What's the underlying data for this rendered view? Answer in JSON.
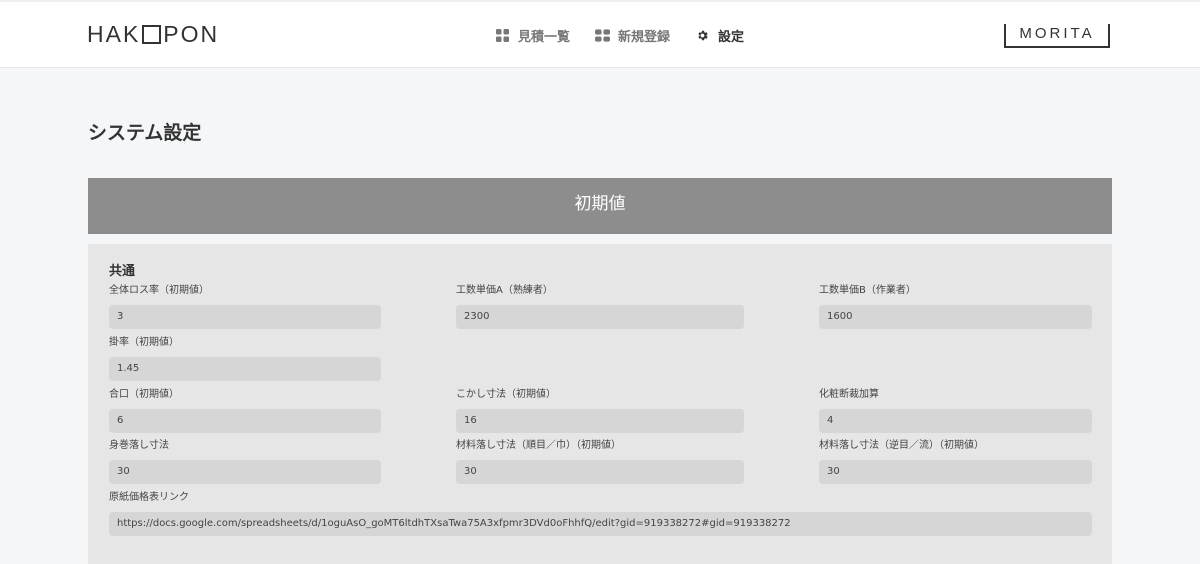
{
  "header": {
    "logo_left": "HAK",
    "logo_right": "PON",
    "nav": [
      {
        "label": "見積一覧",
        "icon": "grid-icon"
      },
      {
        "label": "新規登録",
        "icon": "blocks-icon"
      },
      {
        "label": "設定",
        "icon": "gear-icon"
      }
    ],
    "brand": "MORITA"
  },
  "page": {
    "title": "システム設定",
    "section_title": "初期値",
    "group_title": "共通"
  },
  "fields": {
    "loss_rate": {
      "label": "全体ロス率（初期値）",
      "value": "3"
    },
    "labor_a": {
      "label": "工数単価A（熟練者）",
      "value": "2300"
    },
    "labor_b": {
      "label": "工数単価B（作業者）",
      "value": "1600"
    },
    "markup": {
      "label": "掛率（初期値）",
      "value": "1.45"
    },
    "aikuchi": {
      "label": "合口（初期値）",
      "value": "6"
    },
    "kokashi": {
      "label": "こかし寸法（初期値）",
      "value": "16"
    },
    "keshou": {
      "label": "化粧断裁加算",
      "value": "4"
    },
    "mimaki": {
      "label": "身巻落し寸法",
      "value": "30"
    },
    "material_forward": {
      "label": "材料落し寸法（順目／巾）（初期値）",
      "value": "30"
    },
    "material_reverse": {
      "label": "材料落し寸法（逆目／流）（初期値）",
      "value": "30"
    },
    "price_link": {
      "label": "原紙価格表リンク",
      "value": "https://docs.google.com/spreadsheets/d/1oguAsO_goMT6ltdhTXsaTwa75A3xfpmr3DVd0oFhhfQ/edit?gid=919338272#gid=919338272"
    }
  }
}
